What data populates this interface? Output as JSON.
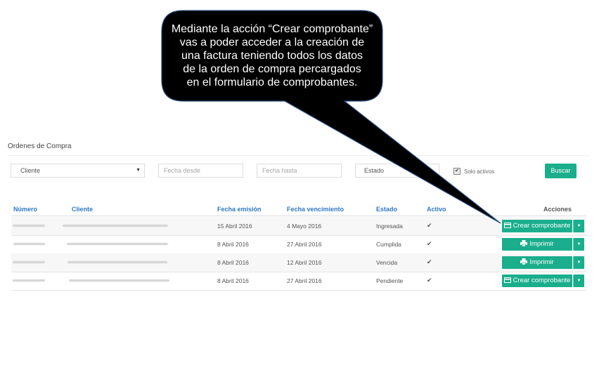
{
  "page_title": "Ordenes de Compra",
  "filters": {
    "cliente": "Cliente",
    "fecha_desde": "Fecha desde",
    "fecha_hasta": "Fecha hasta",
    "estado": "Estado",
    "solo_activos": "Solo activos",
    "solo_activos_checked": true,
    "buscar": "Buscar"
  },
  "table": {
    "headers": {
      "numero": "Número",
      "cliente": "Cliente",
      "fecha_emision": "Fecha emisión",
      "fecha_vencimiento": "Fecha vencimiento",
      "estado": "Estado",
      "activo": "Activo",
      "acciones": "Acciones"
    },
    "rows": [
      {
        "fecha_emision": "15 Abril 2016",
        "fecha_vencimiento": "4 Mayo 2016",
        "estado": "Ingresada",
        "activo": "✔",
        "action": "Crear comprobante",
        "action_icon": "credit-card-icon"
      },
      {
        "fecha_emision": "8 Abril 2016",
        "fecha_vencimiento": "27 Abril 2016",
        "estado": "Cumplida",
        "activo": "✔",
        "action": "Imprimir",
        "action_icon": "printer-icon"
      },
      {
        "fecha_emision": "8 Abril 2016",
        "fecha_vencimiento": "12 Abril 2016",
        "estado": "Vencida",
        "activo": "✔",
        "action": "Imprimir",
        "action_icon": "printer-icon"
      },
      {
        "fecha_emision": "8 Abril 2016",
        "fecha_vencimiento": "27 Abril 2016",
        "estado": "Pendiente",
        "activo": "✔",
        "action": "Crear comprobante",
        "action_icon": "credit-card-icon"
      }
    ]
  },
  "callout": {
    "lines": [
      "Mediante la acción “Crear comprobante”",
      "vas a poder acceder a la creación de",
      "una factura teniendo todos los datos",
      "de la orden de compra percargados",
      "en el formulario de comprobantes."
    ]
  },
  "colors": {
    "accent": "#1aae8c",
    "header_link": "#2f78c4",
    "callout_bg": "#000000"
  }
}
